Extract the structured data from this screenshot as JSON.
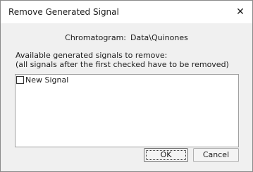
{
  "window": {
    "title": "Remove Generated Signal",
    "close_glyph": "✕"
  },
  "chromatogram": {
    "label": "Chromatogram:",
    "value": "Data\\Quinones"
  },
  "instructions": {
    "line1": "Available generated signals to remove:",
    "line2": "(all signals after the first checked have to be removed)"
  },
  "signals": {
    "items": [
      {
        "label": "New Signal",
        "checked": false
      }
    ]
  },
  "buttons": {
    "ok": "OK",
    "cancel": "Cancel"
  }
}
